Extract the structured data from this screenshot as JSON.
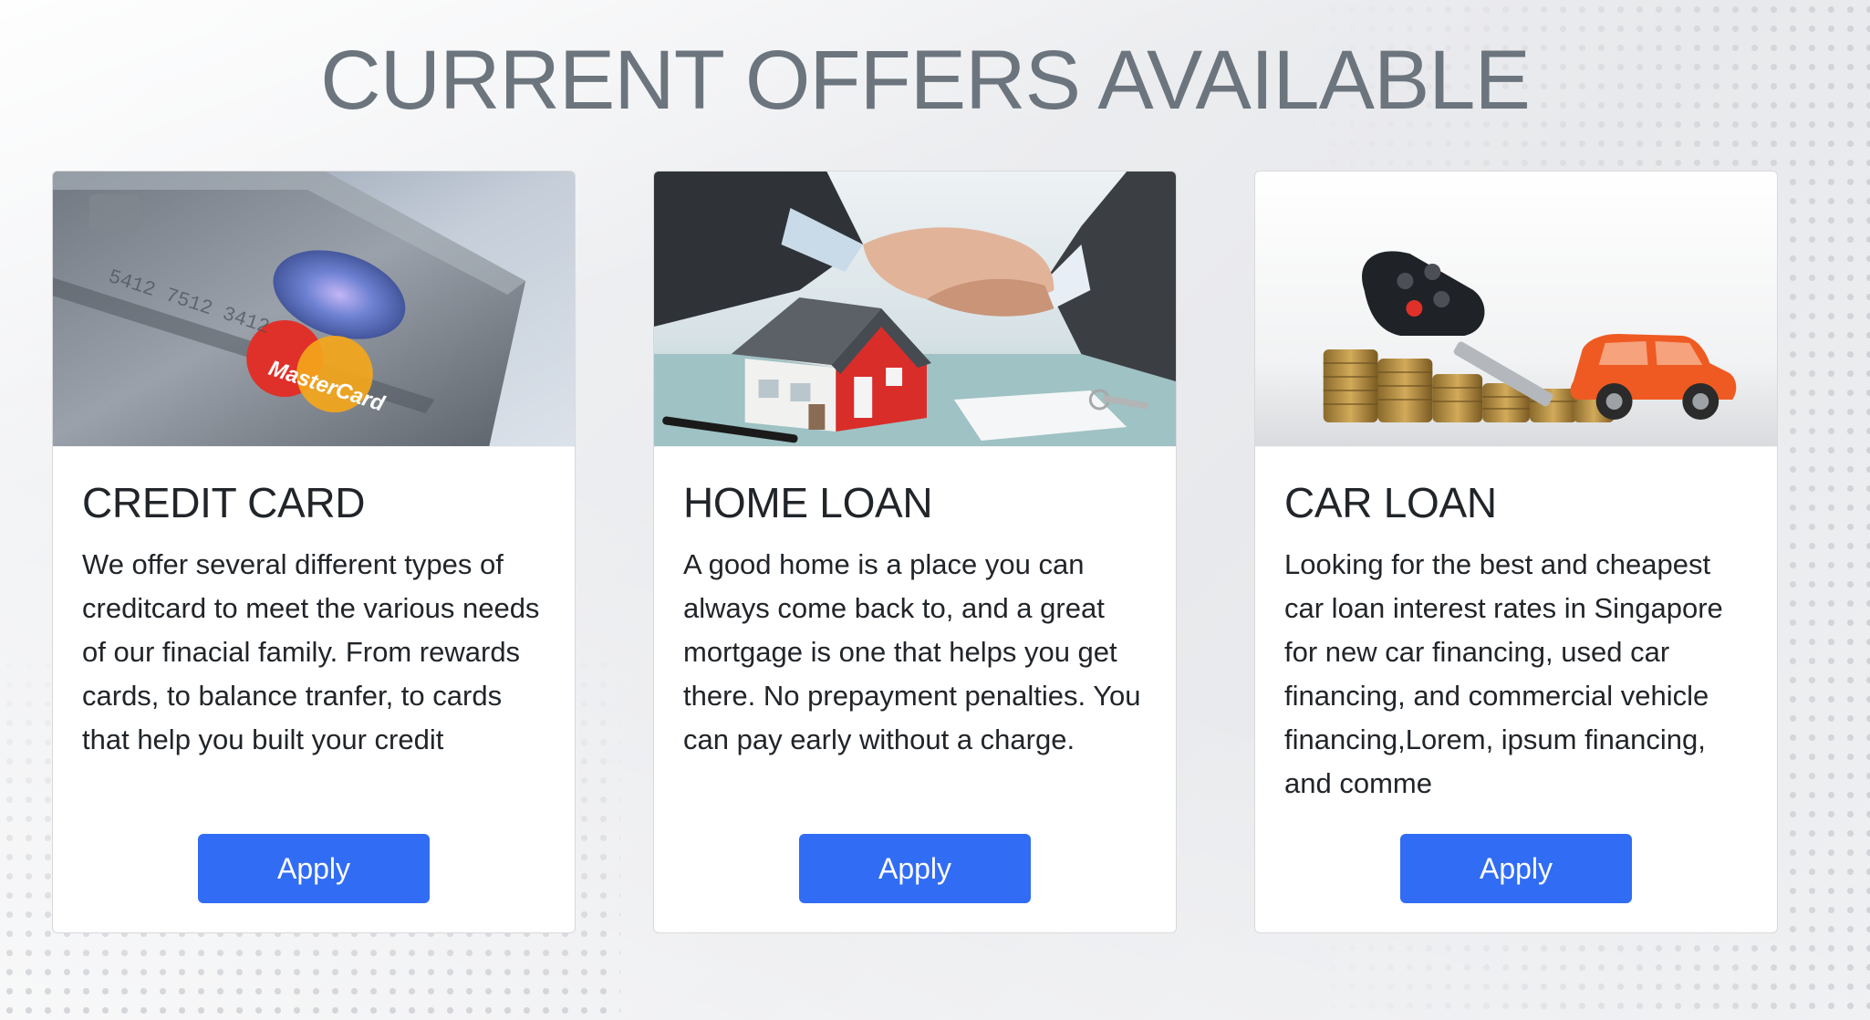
{
  "page": {
    "heading": "CURRENT OFFERS AVAILABLE"
  },
  "offers": [
    {
      "title": "CREDIT CARD",
      "description": "We offer several different types of creditcard to meet the various needs of our finacial family. From rewards cards, to balance tranfer, to cards that help you built your credit",
      "button_label": "Apply",
      "image": "credit-card-photo"
    },
    {
      "title": "HOME LOAN",
      "description": "A good home is a place you can always come back to, and a great mortgage is one that helps you get there. No prepayment penalties. You can pay early without a charge.",
      "button_label": "Apply",
      "image": "handshake-house-photo"
    },
    {
      "title": "CAR LOAN",
      "description": "Looking for the best and cheapest car loan interest rates in Singapore for new car financing, used car financing, and commercial vehicle financing,Lorem, ipsum financing, and comme",
      "button_label": "Apply",
      "image": "car-key-coins-photo"
    }
  ],
  "colors": {
    "button": "#316cf4",
    "heading": "#6c757d",
    "text": "#212529"
  }
}
